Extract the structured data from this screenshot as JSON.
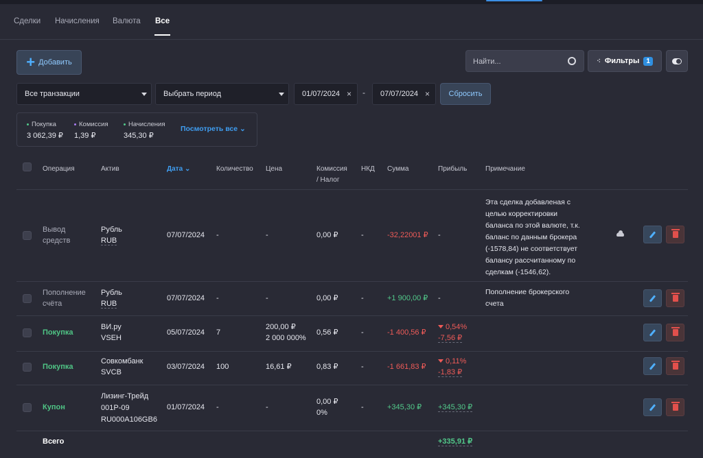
{
  "tabs": [
    "Сделки",
    "Начисления",
    "Валюта",
    "Все"
  ],
  "toolbar": {
    "add_label": "Добавить",
    "search_placeholder": "Найти...",
    "filters_label": "Фильтры",
    "filters_count": "1"
  },
  "filters": {
    "transactions": "Все транзакции",
    "period": "Выбрать период",
    "date_from": "01/07/2024",
    "date_to": "07/07/2024",
    "reset_label": "Сбросить"
  },
  "summary": {
    "items": [
      {
        "label": "Покупка",
        "value": "3 062,39 ₽",
        "dot_color": "#52c98a"
      },
      {
        "label": "Комиссия",
        "value": "1,39 ₽",
        "dot_color": "#a97bf0"
      },
      {
        "label": "Начисления",
        "value": "345,30 ₽",
        "dot_color": "#52c98a"
      }
    ],
    "view_all": "Посмотреть все"
  },
  "table": {
    "headers": {
      "operation": "Операция",
      "asset": "Актив",
      "date": "Дата",
      "quantity": "Количество",
      "price": "Цена",
      "commission_1": "Комиссия",
      "commission_2": "/ Налог",
      "nkd": "НКД",
      "sum": "Сумма",
      "profit": "Прибыль",
      "note": "Примечание"
    },
    "rows": [
      {
        "op1": "Вывод",
        "op2": "средств",
        "asset": "Рубль",
        "ticker": "RUB",
        "date": "07/07/2024",
        "qty": "-",
        "price": "-",
        "commission": "0,00 ₽",
        "nkd": "-",
        "sum": "-32,22001 ₽",
        "profit": "-",
        "note": [
          "Эта сделка добавленая с",
          "целью корректировки",
          "баланса по этой валюте, т.к.",
          "баланс по данным брокера",
          "(-1578,84) не соответствует",
          "балансу рассчитанному по",
          "сделкам (-1546,62)."
        ]
      },
      {
        "op1": "Пополнение",
        "op2": "счёта",
        "asset": "Рубль",
        "ticker": "RUB",
        "date": "07/07/2024",
        "qty": "-",
        "price": "-",
        "commission": "0,00 ₽",
        "nkd": "-",
        "sum": "+1 900,00 ₽",
        "profit": "-",
        "note": [
          "Пополнение брокерского",
          "счета"
        ]
      },
      {
        "op": "Покупка",
        "asset": "ВИ.ру",
        "ticker": "VSEH",
        "date": "05/07/2024",
        "qty": "7",
        "price": "200,00 ₽",
        "price_sub": "2 000 000%",
        "commission": "0,56 ₽",
        "nkd": "-",
        "sum": "-1 400,56 ₽",
        "profit_pct": "0,54%",
        "profit_val": "-7,56 ₽"
      },
      {
        "op": "Покупка",
        "asset": "Совкомбанк",
        "ticker": "SVCB",
        "date": "03/07/2024",
        "qty": "100",
        "price": "16,61 ₽",
        "commission": "0,83 ₽",
        "nkd": "-",
        "sum": "-1 661,83 ₽",
        "profit_pct": "0,11%",
        "profit_val": "-1,83 ₽"
      },
      {
        "op": "Купон",
        "asset1": "Лизинг-Трейд",
        "asset2": "001P-09",
        "ticker": "RU000A106GB6",
        "date": "01/07/2024",
        "qty": "-",
        "price": "-",
        "commission": "0,00 ₽",
        "commission_sub": "0%",
        "nkd": "-",
        "sum": "+345,30 ₽",
        "profit": "+345,30 ₽"
      }
    ],
    "total_label": "Всего",
    "total_profit": "+335,91 ₽"
  }
}
